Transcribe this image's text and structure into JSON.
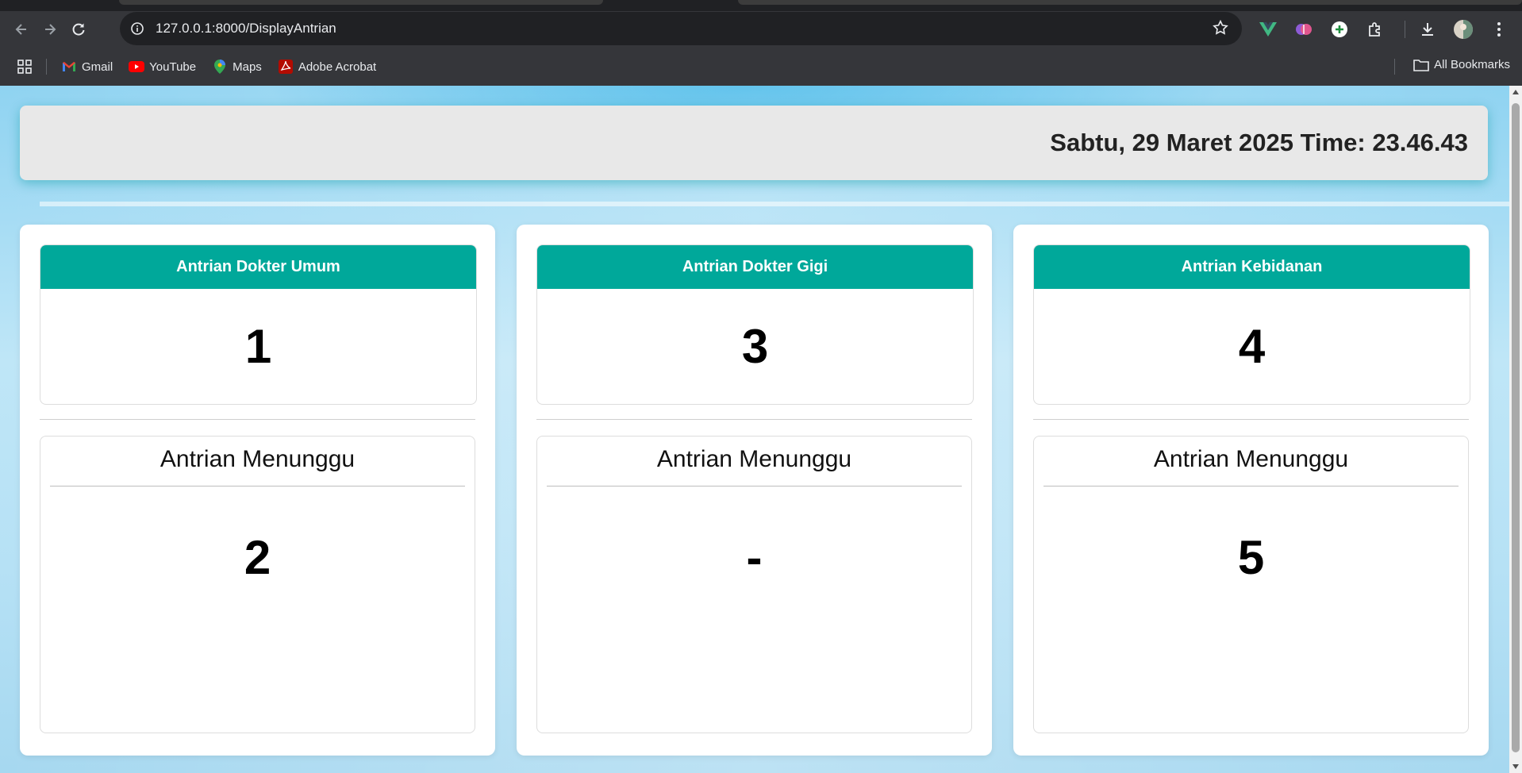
{
  "browser": {
    "url": "127.0.0.1:8000/DisplayAntrian",
    "bookmarks": [
      "Gmail",
      "YouTube",
      "Maps",
      "Adobe Acrobat"
    ],
    "all_bookmarks_label": "All Bookmarks"
  },
  "header": {
    "datetime": "Sabtu, 29 Maret 2025 Time: 23.46.43"
  },
  "queues": [
    {
      "title": "Antrian Dokter Umum",
      "current": "1",
      "waiting_label": "Antrian Menunggu",
      "waiting": "2"
    },
    {
      "title": "Antrian Dokter Gigi",
      "current": "3",
      "waiting_label": "Antrian Menunggu",
      "waiting": "-"
    },
    {
      "title": "Antrian Kebidanan",
      "current": "4",
      "waiting_label": "Antrian Menunggu",
      "waiting": "5"
    }
  ],
  "colors": {
    "accent": "#00a89a",
    "header_bg": "#e8e8e8"
  }
}
